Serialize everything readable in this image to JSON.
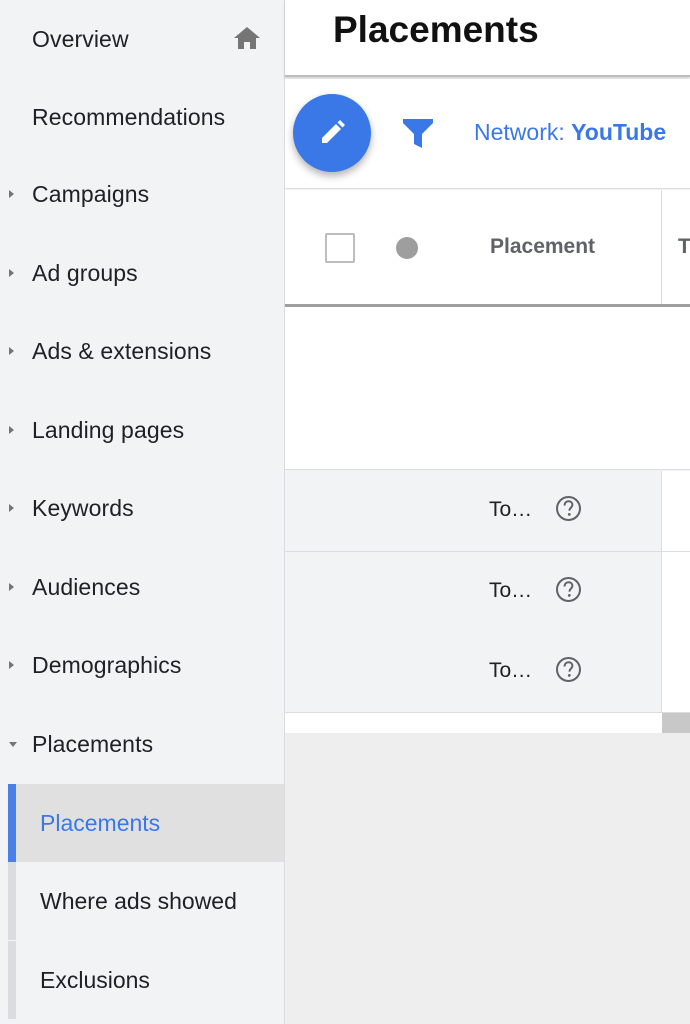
{
  "sidebar": {
    "items": [
      {
        "label": "Overview",
        "icon": "home-icon"
      },
      {
        "label": "Recommendations"
      },
      {
        "label": "Campaigns",
        "expander": "collapsed"
      },
      {
        "label": "Ad groups",
        "expander": "collapsed"
      },
      {
        "label": "Ads & extensions",
        "expander": "collapsed"
      },
      {
        "label": "Landing pages",
        "expander": "collapsed"
      },
      {
        "label": "Keywords",
        "expander": "collapsed"
      },
      {
        "label": "Audiences",
        "expander": "collapsed"
      },
      {
        "label": "Demographics",
        "expander": "collapsed"
      },
      {
        "label": "Placements",
        "expander": "expanded"
      }
    ],
    "sub_items": [
      {
        "label": "Placements",
        "active": true
      },
      {
        "label": "Where ads showed"
      },
      {
        "label": "Exclusions"
      }
    ]
  },
  "header": {
    "title": "Placements"
  },
  "toolbar": {
    "edit_icon": "pencil-icon",
    "filter_icon": "filter-icon",
    "filter_key": "Network: ",
    "filter_value": "YouTube"
  },
  "table": {
    "columns": [
      "Placement",
      "T"
    ],
    "rows": [
      {
        "placement": "To…",
        "icon": "help-icon"
      },
      {
        "placement": "To…",
        "icon": "help-icon"
      },
      {
        "placement": "To…",
        "icon": "help-icon"
      }
    ]
  },
  "colors": {
    "accent": "#3b78e7",
    "sidebar_bg": "#f1f3f4",
    "active_item_bg": "#e0e0e0"
  }
}
